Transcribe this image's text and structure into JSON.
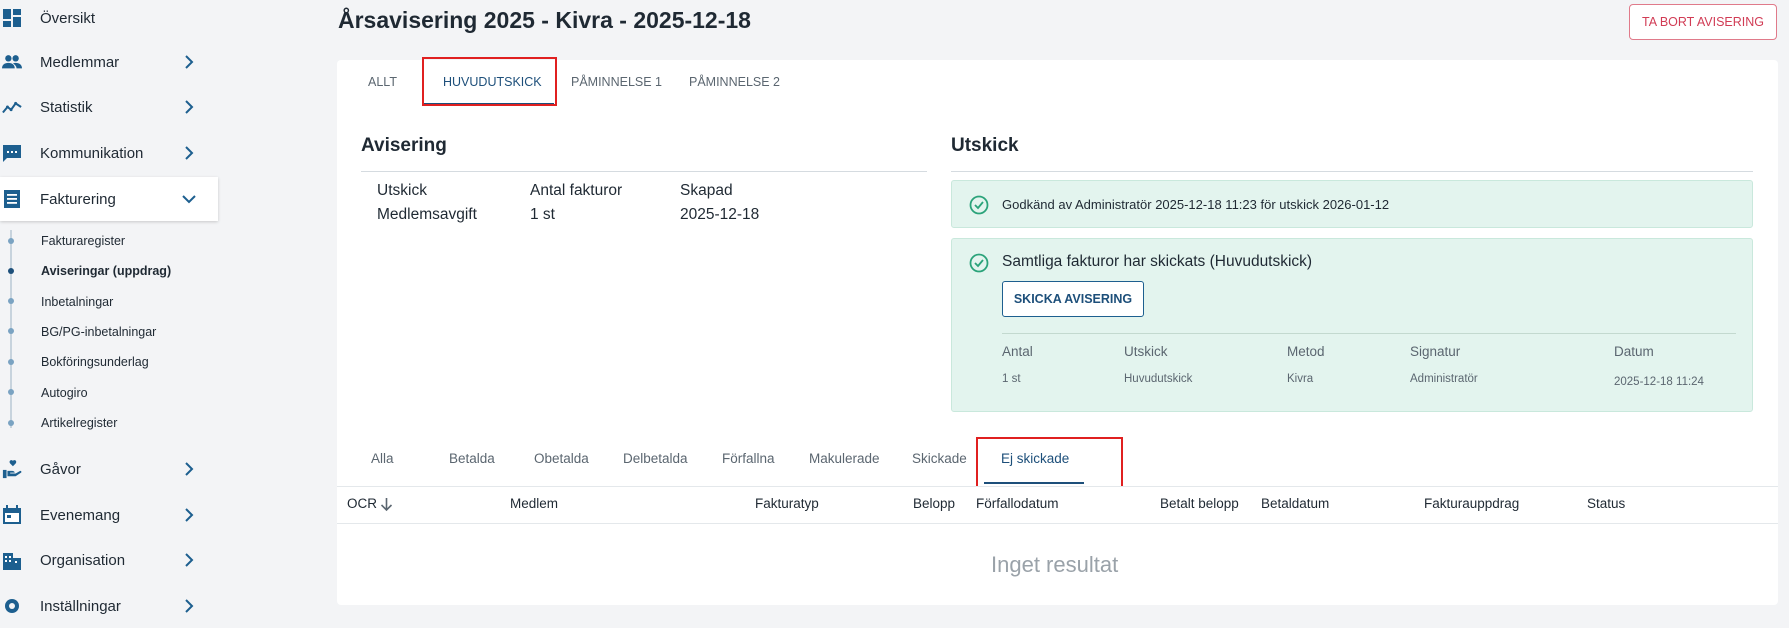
{
  "sidebar": {
    "items": [
      {
        "label": "Översikt",
        "icon": "dashboard-icon"
      },
      {
        "label": "Medlemmar",
        "icon": "people-icon"
      },
      {
        "label": "Statistik",
        "icon": "trend-icon"
      },
      {
        "label": "Kommunikation",
        "icon": "chat-icon"
      },
      {
        "label": "Fakturering",
        "icon": "invoice-icon"
      },
      {
        "label": "Gåvor",
        "icon": "gift-hand-icon"
      },
      {
        "label": "Evenemang",
        "icon": "calendar-icon"
      },
      {
        "label": "Organisation",
        "icon": "building-icon"
      },
      {
        "label": "Inställningar",
        "icon": "gear-icon"
      }
    ],
    "subitems": [
      "Fakturaregister",
      "Aviseringar (uppdrag)",
      "Inbetalningar",
      "BG/PG-inbetalningar",
      "Bokföringsunderlag",
      "Autogiro",
      "Artikelregister"
    ]
  },
  "page": {
    "title": "Årsavisering 2025 - Kivra - 2025-12-18",
    "delete_label": "TA BORT AVISERING"
  },
  "tabs": [
    "ALLT",
    "HUVUDUTSKICK",
    "PÅMINNELSE 1",
    "PÅMINNELSE 2"
  ],
  "avisering": {
    "title": "Avisering",
    "headers": [
      "Utskick",
      "Antal fakturor",
      "Skapad"
    ],
    "values": [
      "Medlemsavgift",
      "1 st",
      "2025-12-18"
    ]
  },
  "utskick": {
    "title": "Utskick",
    "approved_text": "Godkänd av Administratör 2025-12-18 11:23 för utskick 2026-01-12",
    "sent_text": "Samtliga fakturor har skickats (Huvudutskick)",
    "send_label": "SKICKA AVISERING",
    "meta_headers": [
      "Antal",
      "Utskick",
      "Metod",
      "Signatur",
      "Datum"
    ],
    "meta_values": [
      "1 st",
      "Huvudutskick",
      "Kivra",
      "Administratör",
      "2025-12-18 11:24"
    ]
  },
  "filter_tabs": [
    "Alla",
    "Betalda",
    "Obetalda",
    "Delbetalda",
    "Förfallna",
    "Makulerade",
    "Skickade",
    "Ej skickade"
  ],
  "table": {
    "headers": [
      "OCR",
      "Medlem",
      "Fakturatyp",
      "Belopp",
      "Förfallodatum",
      "Betalt belopp",
      "Betaldatum",
      "Fakturauppdrag",
      "Status"
    ],
    "empty_text": "Inget resultat"
  },
  "colors": {
    "accent": "#1d4f7a",
    "danger": "#d13c55",
    "success_bg": "#e3f4ee",
    "success_icon": "#2ba37a",
    "highlight": "#e02020"
  }
}
